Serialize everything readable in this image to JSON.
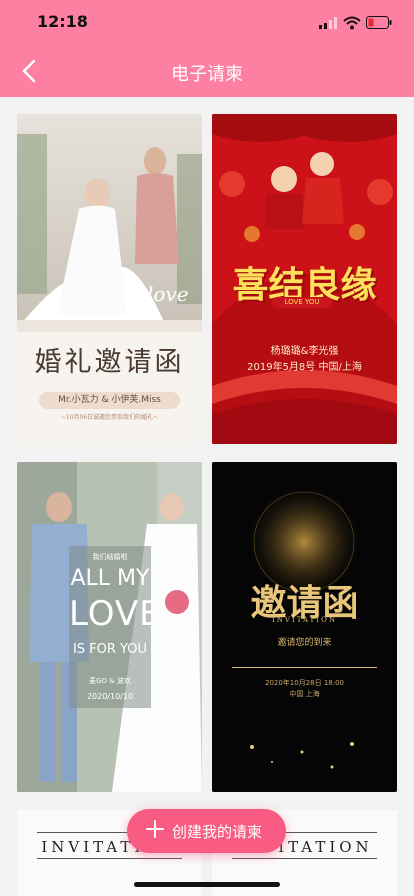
{
  "status_bar": {
    "time": "12:18"
  },
  "nav": {
    "title": "电子请柬"
  },
  "cards": [
    {
      "title": "婚礼邀请函",
      "love": "love",
      "names": "Mr.小瓦力 & 小伊芙.Miss",
      "subtitle": "~10月06日诚邀您参加我们的婚礼~"
    },
    {
      "title": "喜结良缘",
      "subtitle": "LOVE YOU",
      "names": "杨璐璐&李光强",
      "date": "2019年5月8号 中国/上海"
    },
    {
      "top": "我们结婚啦",
      "line1": "ALL MY",
      "line2": "LOVE",
      "line3": "IS FOR YOU",
      "names": "麦GO & 波欢",
      "date": "2020/10/10"
    },
    {
      "title": "邀请函",
      "subtitle": "INVITATION",
      "invite": "邀请您的到来",
      "date": "2020年10月28日 18:00",
      "place": "中国 上海"
    },
    {
      "title": "INVITATION"
    },
    {
      "title": "INVITATION"
    }
  ],
  "create_button": {
    "label": "创建我的请柬"
  },
  "colors": {
    "header": "#fd7fa2",
    "accent": "#f95c83",
    "background": "#f2f2f2"
  }
}
